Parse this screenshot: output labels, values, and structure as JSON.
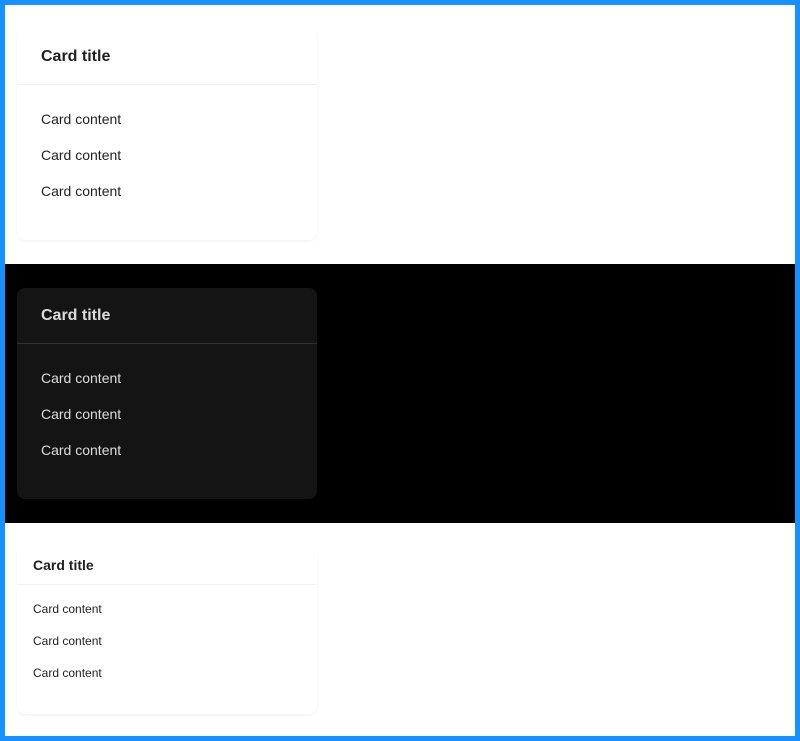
{
  "cards": [
    {
      "theme": "light",
      "size": "default",
      "title": "Card title",
      "lines": [
        "Card content",
        "Card content",
        "Card content"
      ]
    },
    {
      "theme": "dark",
      "size": "default",
      "title": "Card title",
      "lines": [
        "Card content",
        "Card content",
        "Card content"
      ]
    },
    {
      "theme": "light",
      "size": "small",
      "title": "Card title",
      "lines": [
        "Card content",
        "Card content",
        "Card content"
      ]
    }
  ],
  "colors": {
    "frame_border": "#1890ff",
    "light_background": "#ffffff",
    "dark_background": "#000000",
    "dark_card": "#141414"
  }
}
